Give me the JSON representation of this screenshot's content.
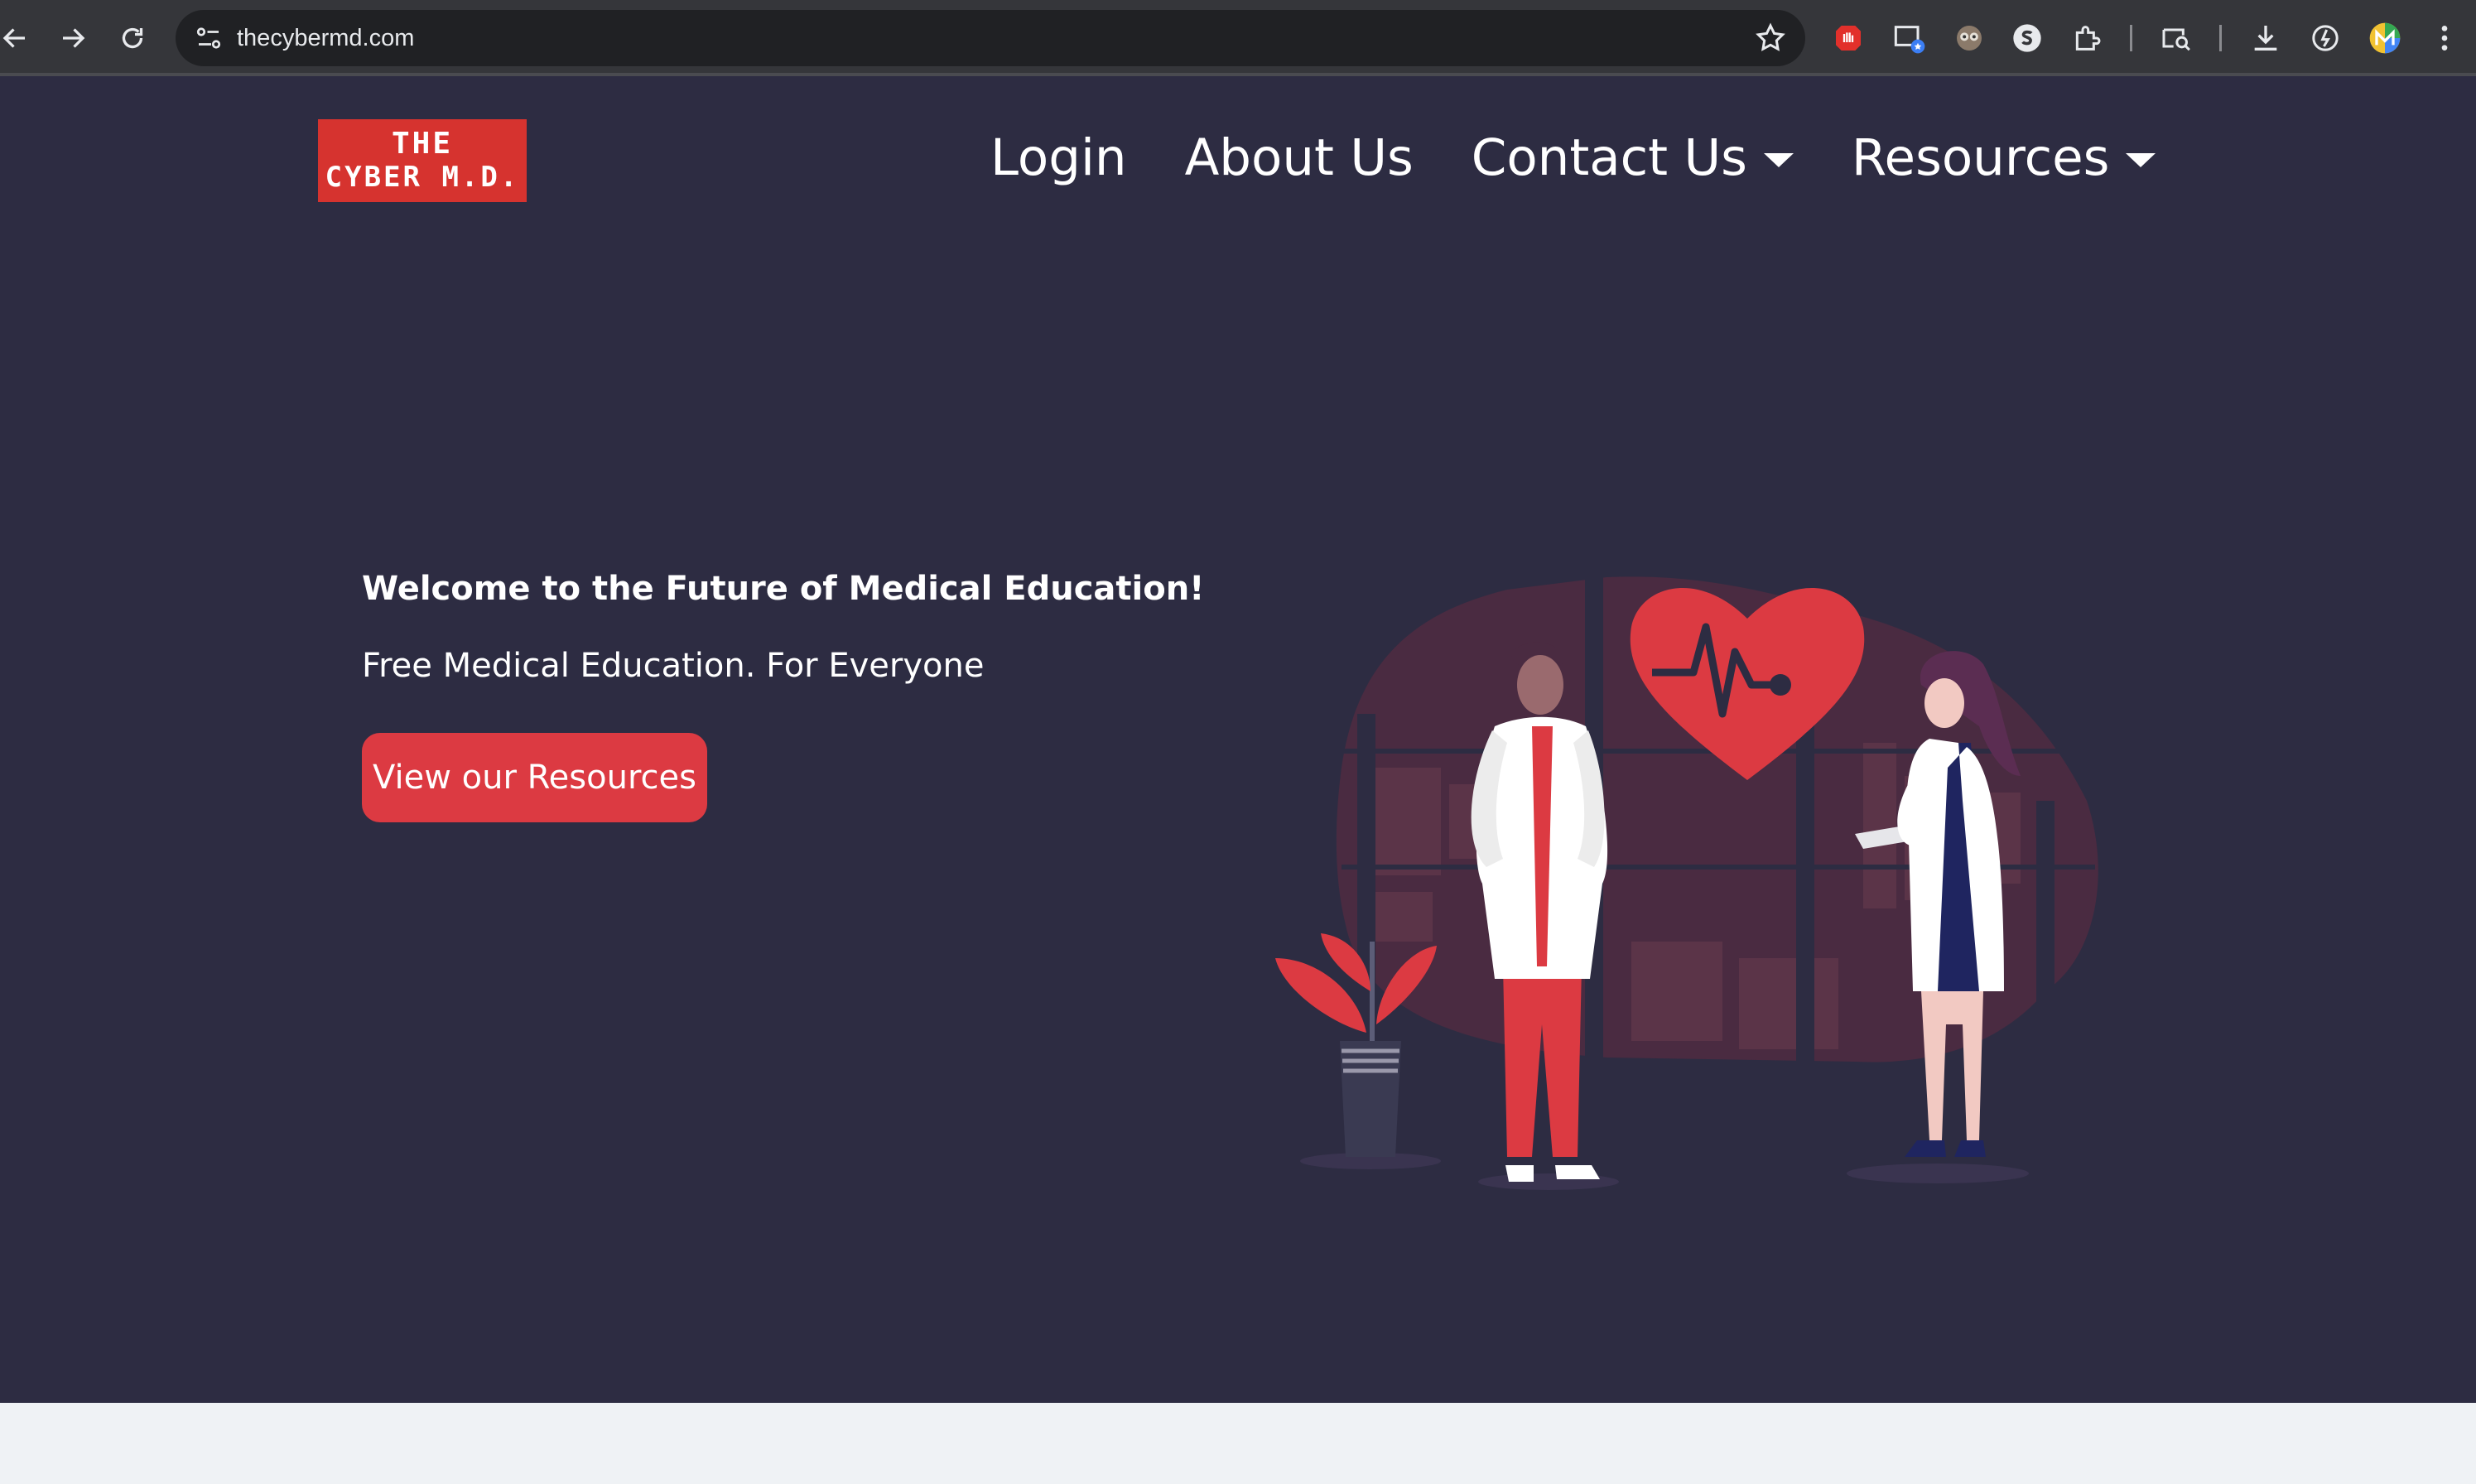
{
  "browser": {
    "url": "thecybermd.com",
    "icons": [
      "back-arrow-icon",
      "forward-arrow-icon",
      "reload-icon",
      "site-settings-icon",
      "star-icon",
      "puzzle-icon",
      "download-icon",
      "menu-icon"
    ]
  },
  "header": {
    "logo": {
      "line1": "THE",
      "line2": "CYBER M.D."
    },
    "nav": {
      "login": "Login",
      "about": "About Us",
      "contact": "Contact Us",
      "resources": "Resources"
    }
  },
  "hero": {
    "title": "Welcome to the Future of Medical Education!",
    "subtitle": "Free Medical Education. For Everyone",
    "cta": "View our Resources"
  },
  "colors": {
    "site_background": "#2d2c42",
    "accent_red": "#dc3a42",
    "logo_red": "#d6332f",
    "footer": "#eff2f5"
  }
}
